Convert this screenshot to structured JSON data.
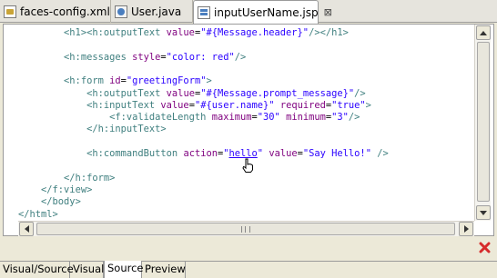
{
  "tabs": [
    {
      "label": "faces-config.xml",
      "icon": "xml-file-icon"
    },
    {
      "label": "User.java",
      "icon": "java-file-icon"
    },
    {
      "label": "inputUserName.jsp",
      "icon": "jsp-file-icon",
      "active": true,
      "close": "⊠"
    }
  ],
  "code_lines": [
    [
      {
        "t": "        "
      },
      {
        "c": "t",
        "t": "<h1><h:outputText "
      },
      {
        "c": "a",
        "t": "value"
      },
      {
        "t": "="
      },
      {
        "c": "v",
        "t": "\"#{Message.header}\""
      },
      {
        "c": "t",
        "t": "/></h1>"
      }
    ],
    [],
    [
      {
        "t": "        "
      },
      {
        "c": "t",
        "t": "<h:messages "
      },
      {
        "c": "a",
        "t": "style"
      },
      {
        "t": "="
      },
      {
        "c": "v",
        "t": "\"color: red\""
      },
      {
        "c": "t",
        "t": "/>"
      }
    ],
    [],
    [
      {
        "t": "        "
      },
      {
        "c": "t",
        "t": "<h:form "
      },
      {
        "c": "a",
        "t": "id"
      },
      {
        "t": "="
      },
      {
        "c": "v",
        "t": "\"greetingForm\""
      },
      {
        "c": "t",
        "t": ">"
      }
    ],
    [
      {
        "t": "            "
      },
      {
        "c": "t",
        "t": "<h:outputText "
      },
      {
        "c": "a",
        "t": "value"
      },
      {
        "t": "="
      },
      {
        "c": "v",
        "t": "\"#{Message.prompt_message}\""
      },
      {
        "c": "t",
        "t": "/>"
      }
    ],
    [
      {
        "t": "            "
      },
      {
        "c": "t",
        "t": "<h:inputText "
      },
      {
        "c": "a",
        "t": "value"
      },
      {
        "t": "="
      },
      {
        "c": "v",
        "t": "\"#{user.name}\""
      },
      {
        "t": " "
      },
      {
        "c": "a",
        "t": "required"
      },
      {
        "t": "="
      },
      {
        "c": "v",
        "t": "\"true\""
      },
      {
        "c": "t",
        "t": ">"
      }
    ],
    [
      {
        "t": "                "
      },
      {
        "c": "t",
        "t": "<f:validateLength "
      },
      {
        "c": "a",
        "t": "maximum"
      },
      {
        "t": "="
      },
      {
        "c": "v",
        "t": "\"30\""
      },
      {
        "t": " "
      },
      {
        "c": "a",
        "t": "minimum"
      },
      {
        "t": "="
      },
      {
        "c": "v",
        "t": "\"3\""
      },
      {
        "c": "t",
        "t": "/>"
      }
    ],
    [
      {
        "t": "            "
      },
      {
        "c": "t",
        "t": "</h:inputText>"
      }
    ],
    [],
    [
      {
        "t": "            "
      },
      {
        "c": "t",
        "t": "<h:commandButton "
      },
      {
        "c": "a",
        "t": "action"
      },
      {
        "t": "="
      },
      {
        "c": "v",
        "t": "\""
      },
      {
        "c": "link",
        "t": "hello"
      },
      {
        "c": "v",
        "t": "\""
      },
      {
        "t": " "
      },
      {
        "c": "a",
        "t": "value"
      },
      {
        "t": "="
      },
      {
        "c": "v",
        "t": "\"Say Hello!\""
      },
      {
        "t": " "
      },
      {
        "c": "t",
        "t": "/>"
      }
    ],
    [],
    [
      {
        "t": "        "
      },
      {
        "c": "t",
        "t": "</h:form>"
      }
    ],
    [
      {
        "t": "    "
      },
      {
        "c": "t",
        "t": "</f:view>"
      }
    ],
    [
      {
        "t": "    "
      },
      {
        "c": "t",
        "t": "</body>"
      }
    ],
    [
      {
        "c": "t",
        "t": "</html>"
      }
    ]
  ],
  "bottom_tabs": [
    {
      "label": "Visual/Source"
    },
    {
      "label": "Visual"
    },
    {
      "label": "Source",
      "active": true
    },
    {
      "label": "Preview"
    }
  ],
  "colors": {
    "tag": "#3f7f7f",
    "attribute": "#7f007f",
    "value": "#2a00ff",
    "error": "#d62b2b"
  }
}
